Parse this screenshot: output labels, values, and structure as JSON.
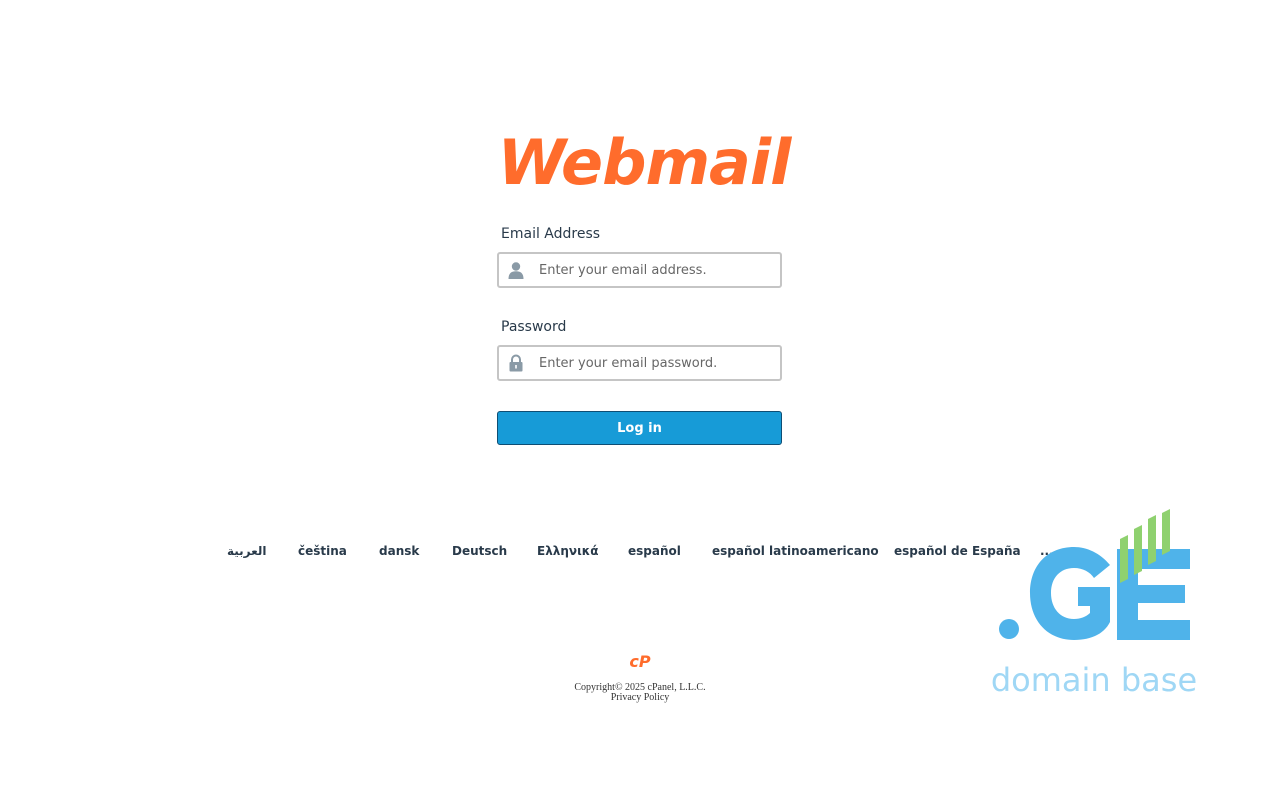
{
  "brand": {
    "logo_text": "Webmail",
    "logo_color": "#ff6c2c"
  },
  "form": {
    "email": {
      "label": "Email Address",
      "placeholder": "Enter your email address.",
      "value": "",
      "icon": "user-icon"
    },
    "password": {
      "label": "Password",
      "placeholder": "Enter your email password.",
      "value": "",
      "icon": "lock-icon"
    },
    "login_button": "Log in",
    "accent_color": "#179bd7"
  },
  "languages": [
    "العربية",
    "čeština",
    "dansk",
    "Deutsch",
    "Ελληνικά",
    "español",
    "español latinoamericano",
    "español de España",
    "..."
  ],
  "footer": {
    "cpanel_logo_text": "cP",
    "copyright": "Copyright© 2025 cPanel, L.L.C.",
    "privacy": "Privacy Policy"
  },
  "partner": {
    "logo_text": ".GE",
    "tagline": "domain base",
    "colors": {
      "blue": "#4fb3ea",
      "green": "#8fd16f",
      "light_blue": "#9fd7f5"
    }
  }
}
